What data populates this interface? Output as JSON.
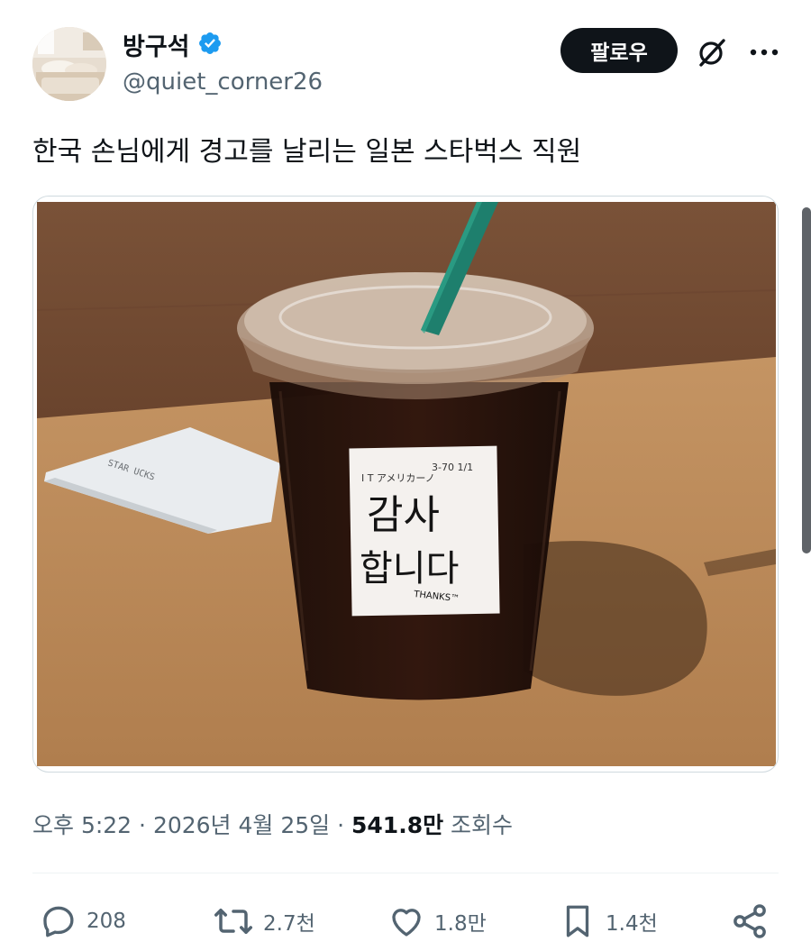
{
  "author": {
    "display_name": "방구석",
    "handle": "@quiet_corner26",
    "verified": true,
    "verified_color": "#1d9bf0"
  },
  "header": {
    "follow_label": "팔로우",
    "grok_icon": "grok-slash-icon",
    "more_icon": "more-dots-icon"
  },
  "tweet": {
    "text": "한국 손님에게 경고를 날리는 일본 스타벅스 직원"
  },
  "media": {
    "sticker_line1": "I T アメリカーノ",
    "sticker_code": "3-70  1/1",
    "sticker_handwriting_1": "감사",
    "sticker_handwriting_2": "합니다",
    "sticker_thanks": "THANKS™",
    "receipt_text": "STAR  UCKS"
  },
  "meta": {
    "time": "오후 5:22",
    "sep1": " · ",
    "date": "2026년 4월 25일",
    "sep2": " · ",
    "views_count": "541.8만",
    "views_label": " 조회수"
  },
  "actions": {
    "replies": "208",
    "retweets": "2.7천",
    "likes": "1.8만",
    "bookmarks": "1.4천"
  },
  "colors": {
    "text_primary": "#0f1419",
    "text_secondary": "#536471",
    "follow_bg": "#0f1419"
  }
}
